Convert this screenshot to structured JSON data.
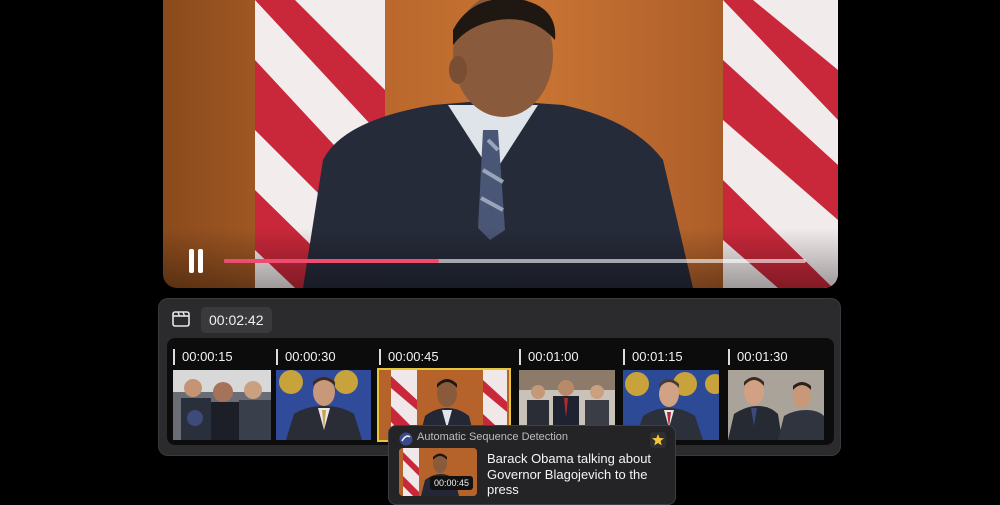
{
  "player": {
    "progress": 0.37,
    "controls": {
      "pause_icon": "pause-icon"
    },
    "accent_color": "#ef4b6e"
  },
  "timeline": {
    "current_time": "00:02:42",
    "icon": "clapperboard-icon",
    "shots": [
      {
        "time": "00:00:15",
        "selected": false
      },
      {
        "time": "00:00:30",
        "selected": false
      },
      {
        "time": "00:00:45",
        "selected": true
      },
      {
        "time": "00:01:00",
        "selected": false
      },
      {
        "time": "00:01:15",
        "selected": false
      },
      {
        "time": "00:01:30",
        "selected": false
      }
    ],
    "selected_color": "#e7c73a"
  },
  "popup": {
    "header": "Automatic Sequence Detection",
    "thumb_time": "00:00:45",
    "description": "Barack Obama talking about Governor Blagojevich to the press",
    "star_icon": "star-icon"
  }
}
